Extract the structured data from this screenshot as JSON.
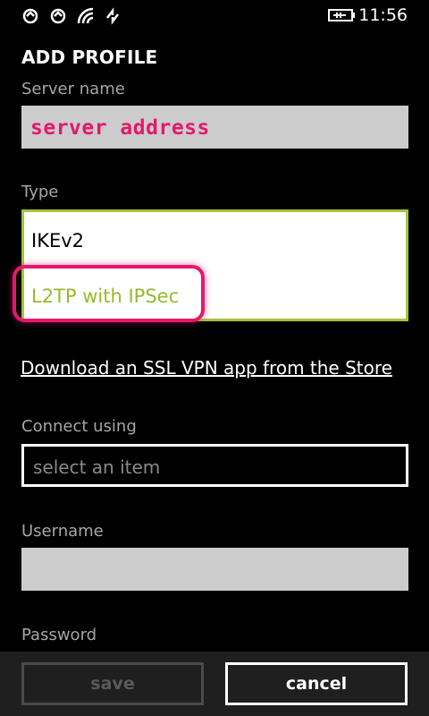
{
  "status_bar": {
    "time": "11:56",
    "icons": [
      "dual-sim-1-icon",
      "dual-sim-2-icon",
      "wifi-icon",
      "data-sync-icon",
      "battery-charging-icon"
    ]
  },
  "page": {
    "title": "ADD PROFILE"
  },
  "form": {
    "server_name": {
      "label": "Server name",
      "value": "server address"
    },
    "type": {
      "label": "Type",
      "options": [
        "IKEv2",
        "L2TP with IPSec"
      ],
      "highlighted": "L2TP with IPSec"
    },
    "store_link": "Download an SSL VPN app from the Store",
    "connect_using": {
      "label": "Connect using",
      "placeholder": "select an item"
    },
    "username": {
      "label": "Username",
      "value": ""
    },
    "password": {
      "label": "Password"
    }
  },
  "app_bar": {
    "save_label": "save",
    "cancel_label": "cancel"
  },
  "colors": {
    "accent_green": "#a5c43a",
    "annotation_pink": "#e5186c",
    "field_gray": "#cccccc"
  }
}
